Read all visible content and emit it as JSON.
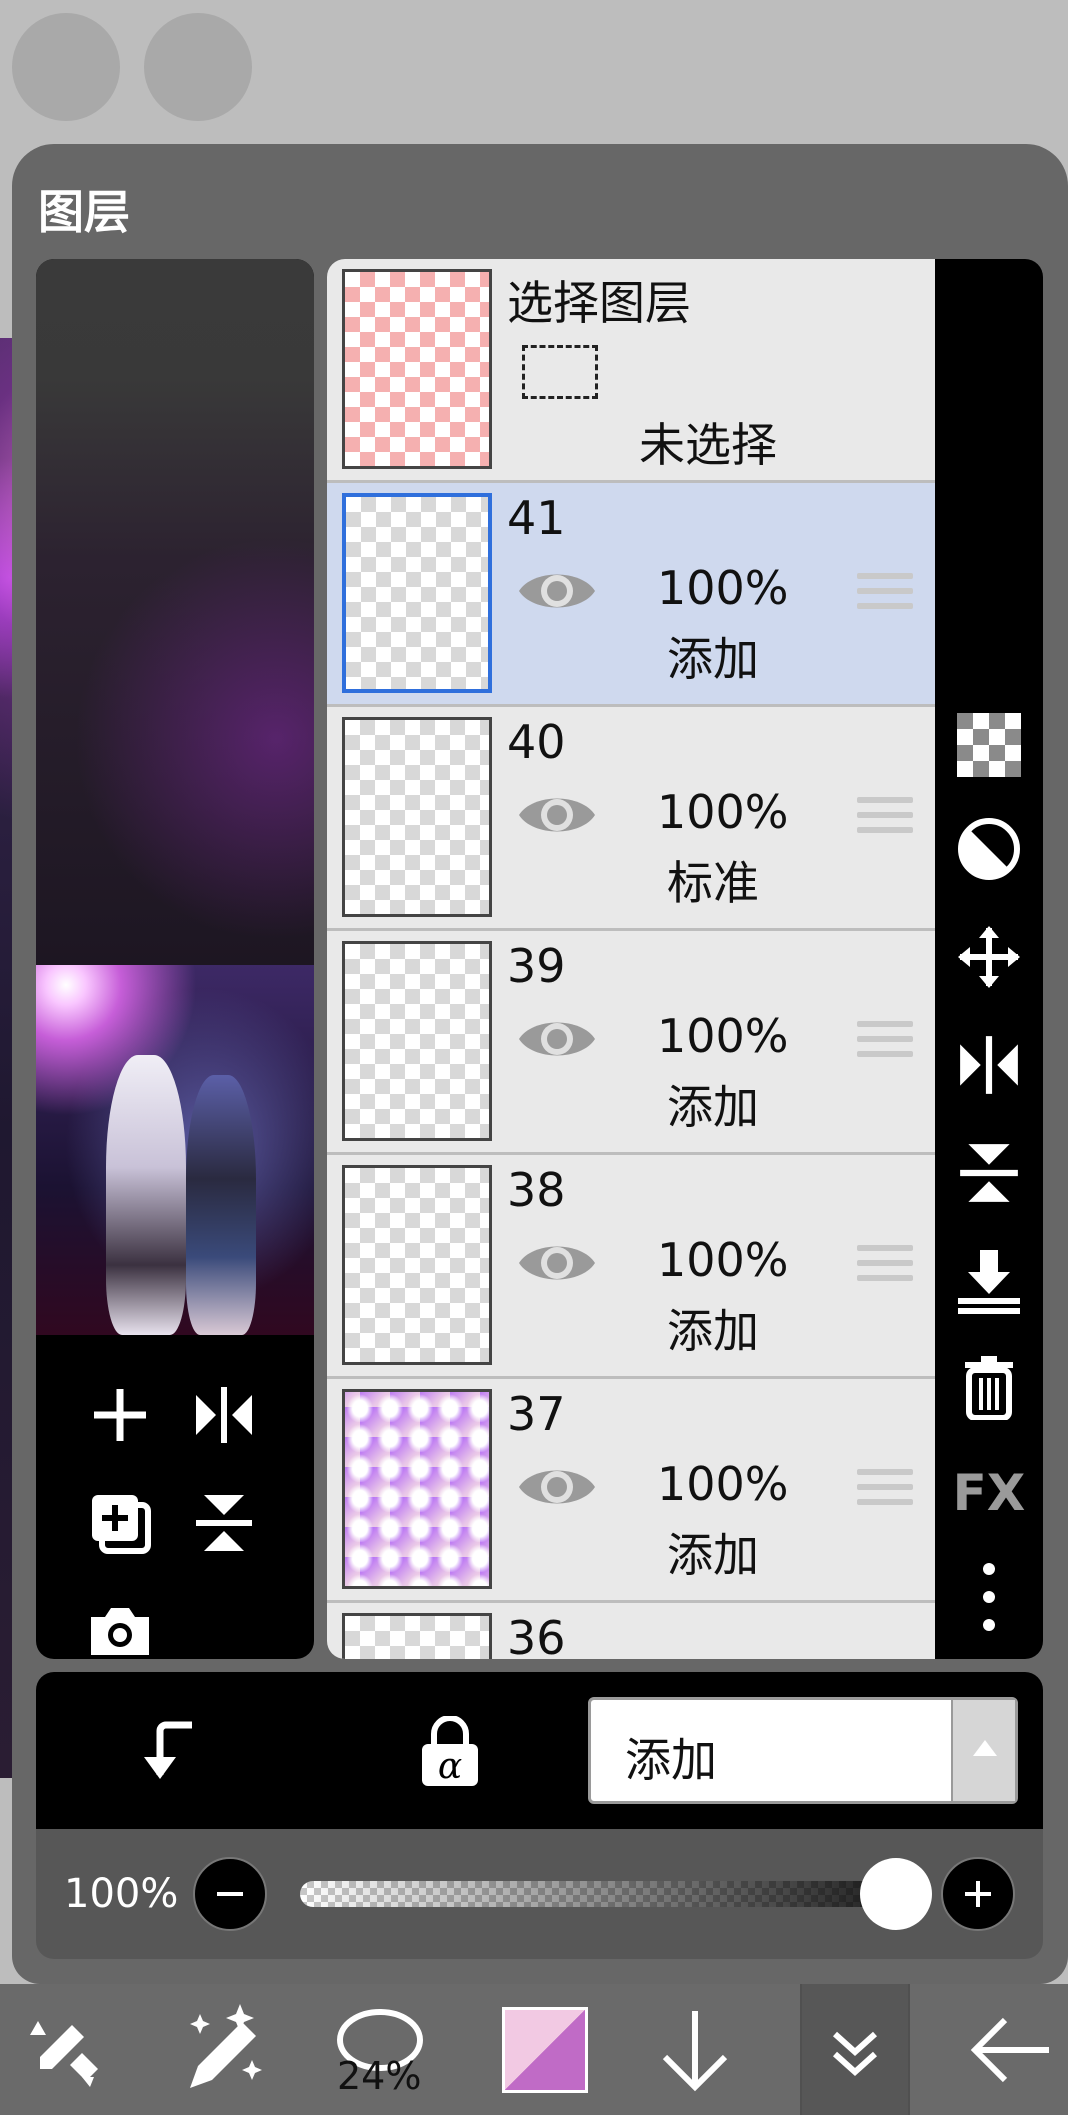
{
  "panel": {
    "title": "图层"
  },
  "selection_layer": {
    "title": "选择图层",
    "status": "未选择"
  },
  "layers": [
    {
      "number": "41",
      "opacity": "100%",
      "blend": "添加",
      "selected": true
    },
    {
      "number": "40",
      "opacity": "100%",
      "blend": "标准",
      "selected": false
    },
    {
      "number": "39",
      "opacity": "100%",
      "blend": "添加",
      "selected": false
    },
    {
      "number": "38",
      "opacity": "100%",
      "blend": "添加",
      "selected": false
    },
    {
      "number": "37",
      "opacity": "100%",
      "blend": "添加",
      "selected": false
    },
    {
      "number": "36",
      "opacity": "",
      "blend": "",
      "selected": false
    }
  ],
  "right_tools": [
    "checker-icon",
    "half-circle-icon",
    "move-icon",
    "flip-horizontal-icon",
    "flip-vertical-icon",
    "merge-down-icon",
    "trash-icon",
    "fx-icon",
    "more-vertical-icon"
  ],
  "right_tools_fx_label": "FX",
  "left_tools": [
    "add-layer-icon",
    "flip-horizontal-icon",
    "duplicate-layer-icon",
    "flip-vertical-icon",
    "camera-icon"
  ],
  "blend_mode": {
    "current": "添加"
  },
  "opacity_control": {
    "label": "100%",
    "value_percent": 100
  },
  "toolbar": {
    "brush_size_label": "24%"
  },
  "colors": {
    "selected_row": "#cfd9ee",
    "selected_border": "#2f6fdc",
    "panel": "#676767"
  }
}
